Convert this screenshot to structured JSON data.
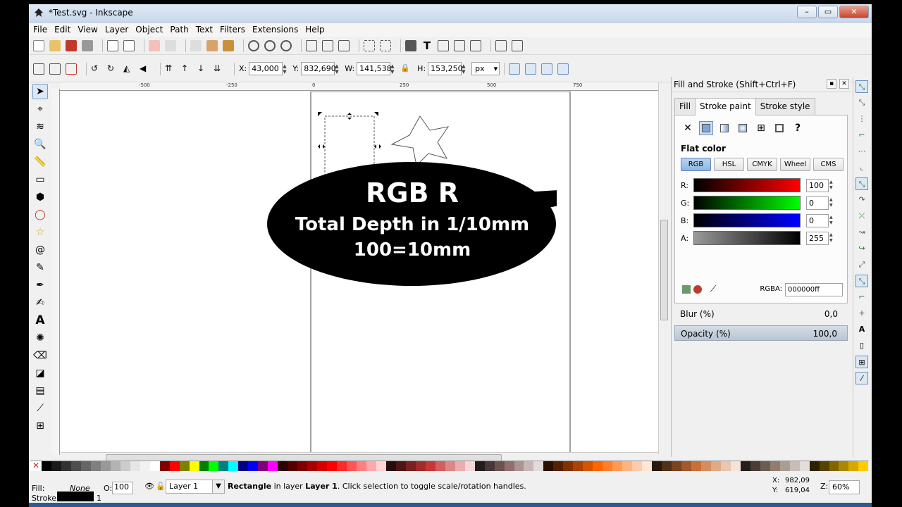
{
  "window": {
    "title": "*Test.svg - Inkscape",
    "buttons": [
      "–",
      "▭",
      "✕"
    ]
  },
  "menu": [
    "File",
    "Edit",
    "View",
    "Layer",
    "Object",
    "Path",
    "Text",
    "Filters",
    "Extensions",
    "Help"
  ],
  "select_toolbar": {
    "x_label": "X:",
    "x_value": "43,000",
    "y_label": "Y:",
    "y_value": "832,690",
    "w_label": "W:",
    "w_value": "141,538",
    "h_label": "H:",
    "h_value": "153,250",
    "unit": "px"
  },
  "ruler_labels": [
    "-500",
    "-250",
    "0",
    "250",
    "500",
    "750"
  ],
  "overlay": {
    "line1": "RGB R",
    "line2": "Total Depth in 1/10mm",
    "line3": "100=10mm"
  },
  "dialog": {
    "title": "Fill and Stroke (Shift+Ctrl+F)",
    "tabs": {
      "fill": "Fill",
      "stroke_paint": "Stroke paint",
      "stroke_style": "Stroke style"
    },
    "flat_color_label": "Flat color",
    "modes": [
      "RGB",
      "HSL",
      "CMYK",
      "Wheel",
      "CMS"
    ],
    "channels": [
      {
        "label": "R:",
        "value": "100"
      },
      {
        "label": "G:",
        "value": "0"
      },
      {
        "label": "B:",
        "value": "0"
      },
      {
        "label": "A:",
        "value": "255"
      }
    ],
    "rgba_label": "RGBA:",
    "rgba_value": "000000ff",
    "blur_label": "Blur (%)",
    "blur_value": "0,0",
    "opacity_label": "Opacity (%)",
    "opacity_value": "100,0"
  },
  "status": {
    "fill_label": "Fill:",
    "fill_value": "None",
    "stroke_label": "Stroke:",
    "stroke_width": "1",
    "opacity_label": "O:",
    "opacity_value": "100",
    "layer": "Layer 1",
    "message_obj": "Rectangle",
    "message_mid": " in layer ",
    "message_layer": "Layer 1",
    "message_end": ". Click selection to toggle scale/rotation handles.",
    "x_label": "X:",
    "x_value": "982,09",
    "y_label": "Y:",
    "y_value": "619,04",
    "zoom_label": "Z:",
    "zoom_value": "60%"
  },
  "colors": {
    "palette": [
      "#000000",
      "#1a1a1a",
      "#333333",
      "#4d4d4d",
      "#666666",
      "#808080",
      "#999999",
      "#b3b3b3",
      "#cccccc",
      "#e6e6e6",
      "#f2f2f2",
      "#ffffff",
      "#800000",
      "#ff0000",
      "#808000",
      "#ffff00",
      "#008000",
      "#00ff00",
      "#008080",
      "#00ffff",
      "#000080",
      "#0000ff",
      "#800080",
      "#ff00ff",
      "#2b0000",
      "#550000",
      "#800000",
      "#aa0000",
      "#d40000",
      "#ff0000",
      "#ff2a2a",
      "#ff5555",
      "#ff8080",
      "#ffaaaa",
      "#ffd5d5",
      "#280b0b",
      "#501616",
      "#782121",
      "#a02c2c",
      "#c83737",
      "#d35f5f",
      "#de8787",
      "#e9afaf",
      "#f4d7d7",
      "#241c1c",
      "#483737",
      "#6c5353",
      "#916f6f",
      "#ac9393",
      "#c8b7b7",
      "#e3dbdb",
      "#2b1100",
      "#552200",
      "#803300",
      "#aa4400",
      "#d45500",
      "#ff6600",
      "#ff7f2a",
      "#ff9955",
      "#ffb380",
      "#ffccaa",
      "#ffe6d5",
      "#281a0b",
      "#503216",
      "#784421",
      "#a05a2c",
      "#c87137",
      "#d38d5f",
      "#deaa87",
      "#e9c6af",
      "#f4e3d7",
      "#241f1c",
      "#483e37",
      "#6c5d53",
      "#917c6f",
      "#ac9d93",
      "#c8beb7",
      "#e3dedb",
      "#2b2200",
      "#554400",
      "#806600",
      "#aa8800",
      "#d4aa00",
      "#ffcc00"
    ]
  }
}
